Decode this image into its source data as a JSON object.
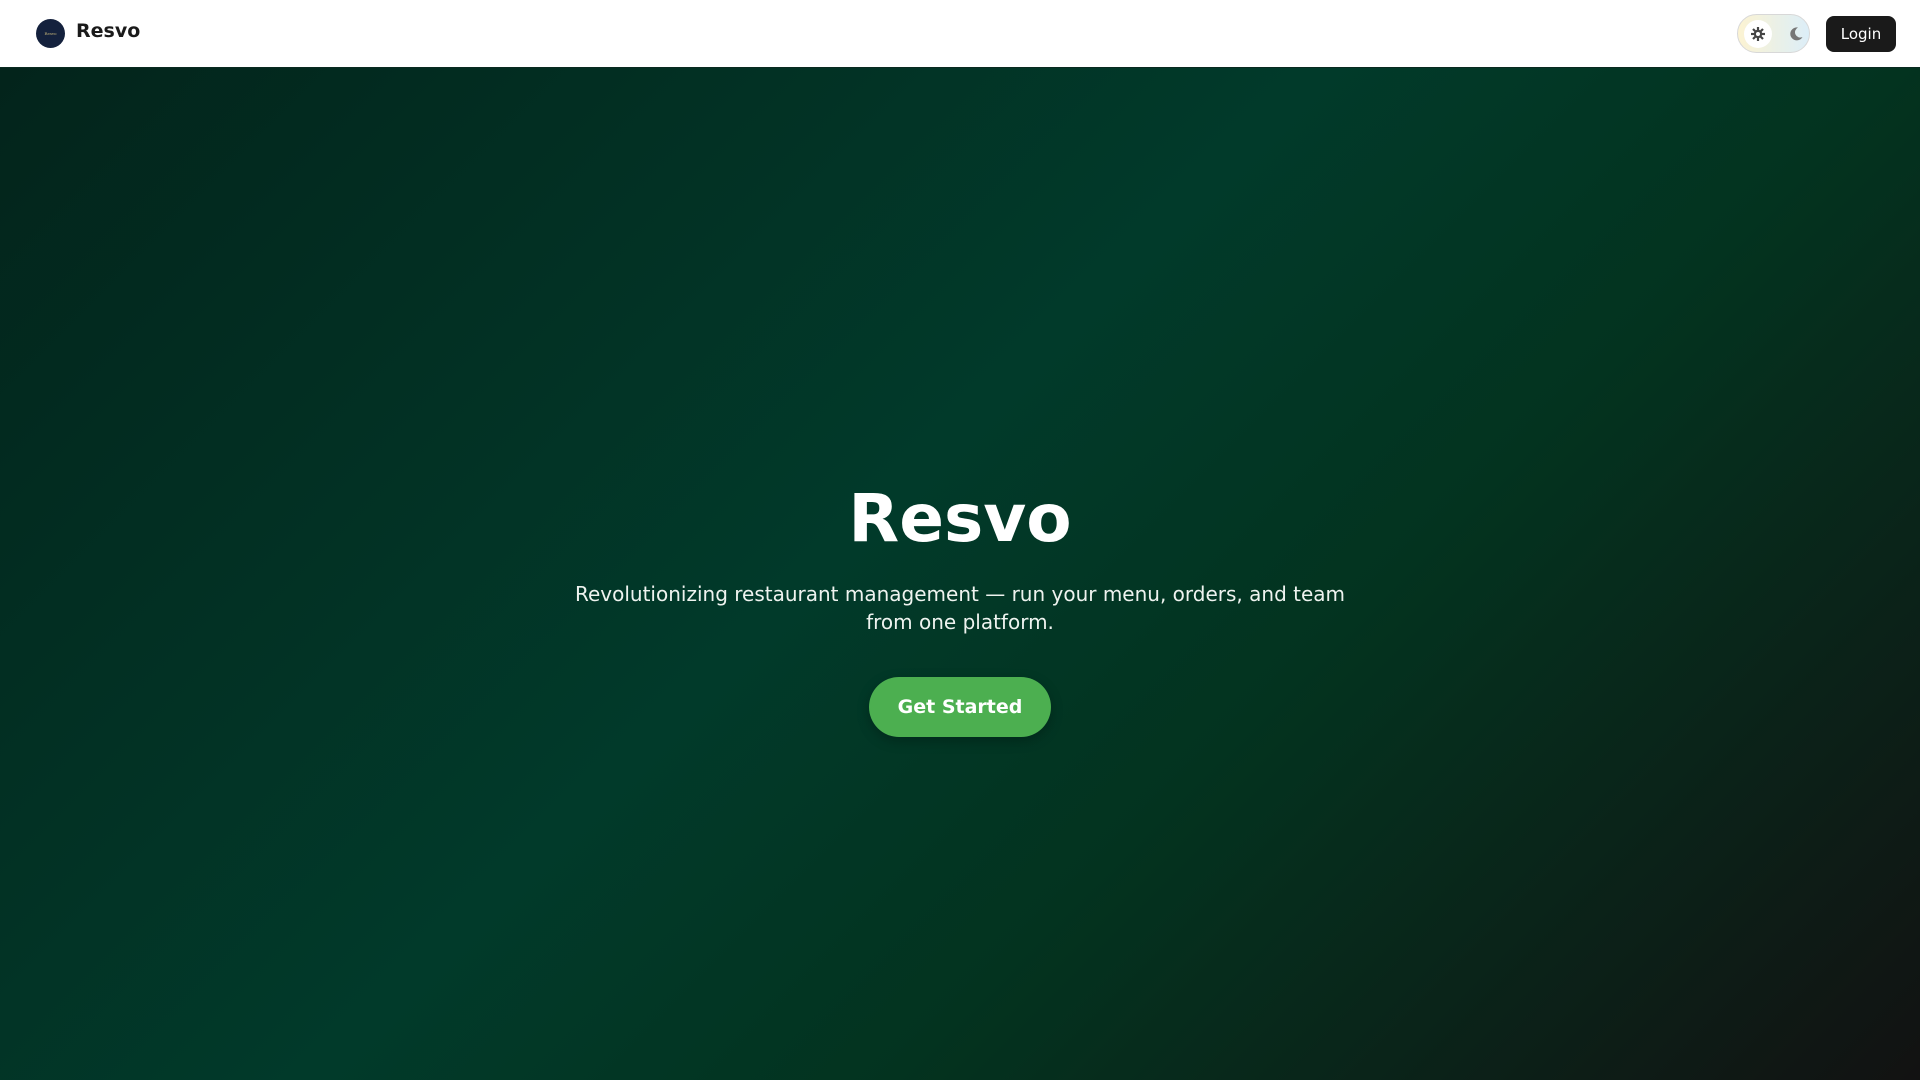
{
  "header": {
    "logo_text": "Resvo",
    "brand": "Resvo",
    "theme_toggle": {
      "light_icon": "sun-icon",
      "dark_icon": "moon-icon",
      "selected": "light"
    },
    "login_label": "Login"
  },
  "hero": {
    "title": "Resvo",
    "subtitle": "Revolutionizing restaurant management — run your menu, orders, and team from one platform.",
    "cta_label": "Get Started"
  },
  "colors": {
    "accent": "#4caf50",
    "login_bg": "#1a1a1a",
    "hero_dark_green": "#013a2a"
  }
}
